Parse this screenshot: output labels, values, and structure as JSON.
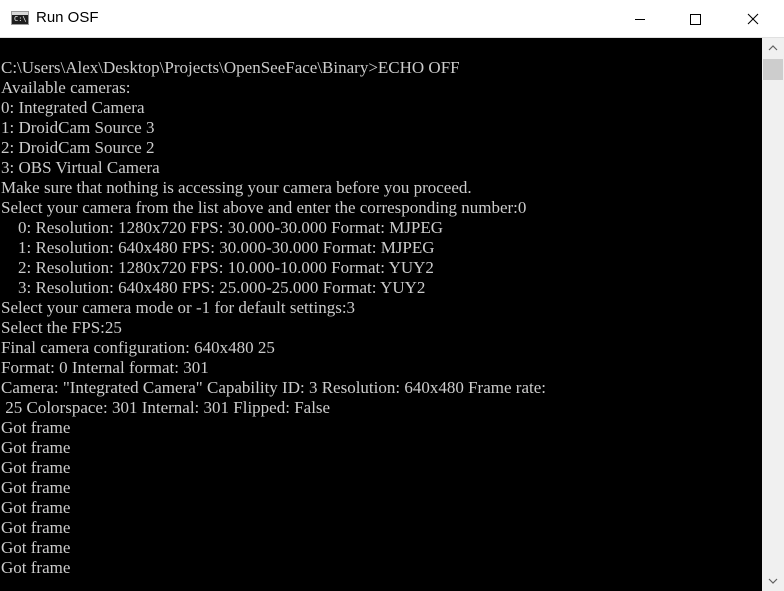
{
  "window": {
    "title": "Run OSF",
    "icon": "console-app-icon",
    "icon_glyph": "C:\\"
  },
  "controls": {
    "minimize_icon": "minimize-icon",
    "maximize_icon": "maximize-icon",
    "close_icon": "close-icon"
  },
  "console": {
    "background": "#000000",
    "foreground": "#cccccc",
    "lines": [
      "C:\\Users\\Alex\\Desktop\\Projects\\OpenSeeFace\\Binary>ECHO OFF",
      "Available cameras:",
      "0: Integrated Camera",
      "1: DroidCam Source 3",
      "2: DroidCam Source 2",
      "3: OBS Virtual Camera",
      "Make sure that nothing is accessing your camera before you proceed.",
      "Select your camera from the list above and enter the corresponding number:0",
      "    0: Resolution: 1280x720 FPS: 30.000-30.000 Format: MJPEG",
      "    1: Resolution: 640x480 FPS: 30.000-30.000 Format: MJPEG",
      "    2: Resolution: 1280x720 FPS: 10.000-10.000 Format: YUY2",
      "    3: Resolution: 640x480 FPS: 25.000-25.000 Format: YUY2",
      "Select your camera mode or -1 for default settings:3",
      "Select the FPS:25",
      "Final camera configuration: 640x480 25",
      "Format: 0 Internal format: 301",
      "Camera: \"Integrated Camera\" Capability ID: 3 Resolution: 640x480 Frame rate:",
      " 25 Colorspace: 301 Internal: 301 Flipped: False",
      "Got frame",
      "Got frame",
      "Got frame",
      "Got frame",
      "Got frame",
      "Got frame",
      "Got frame",
      "Got frame"
    ]
  },
  "scrollbar": {
    "up_icon": "scroll-up-arrow-icon",
    "down_icon": "scroll-down-arrow-icon",
    "position": 0
  }
}
